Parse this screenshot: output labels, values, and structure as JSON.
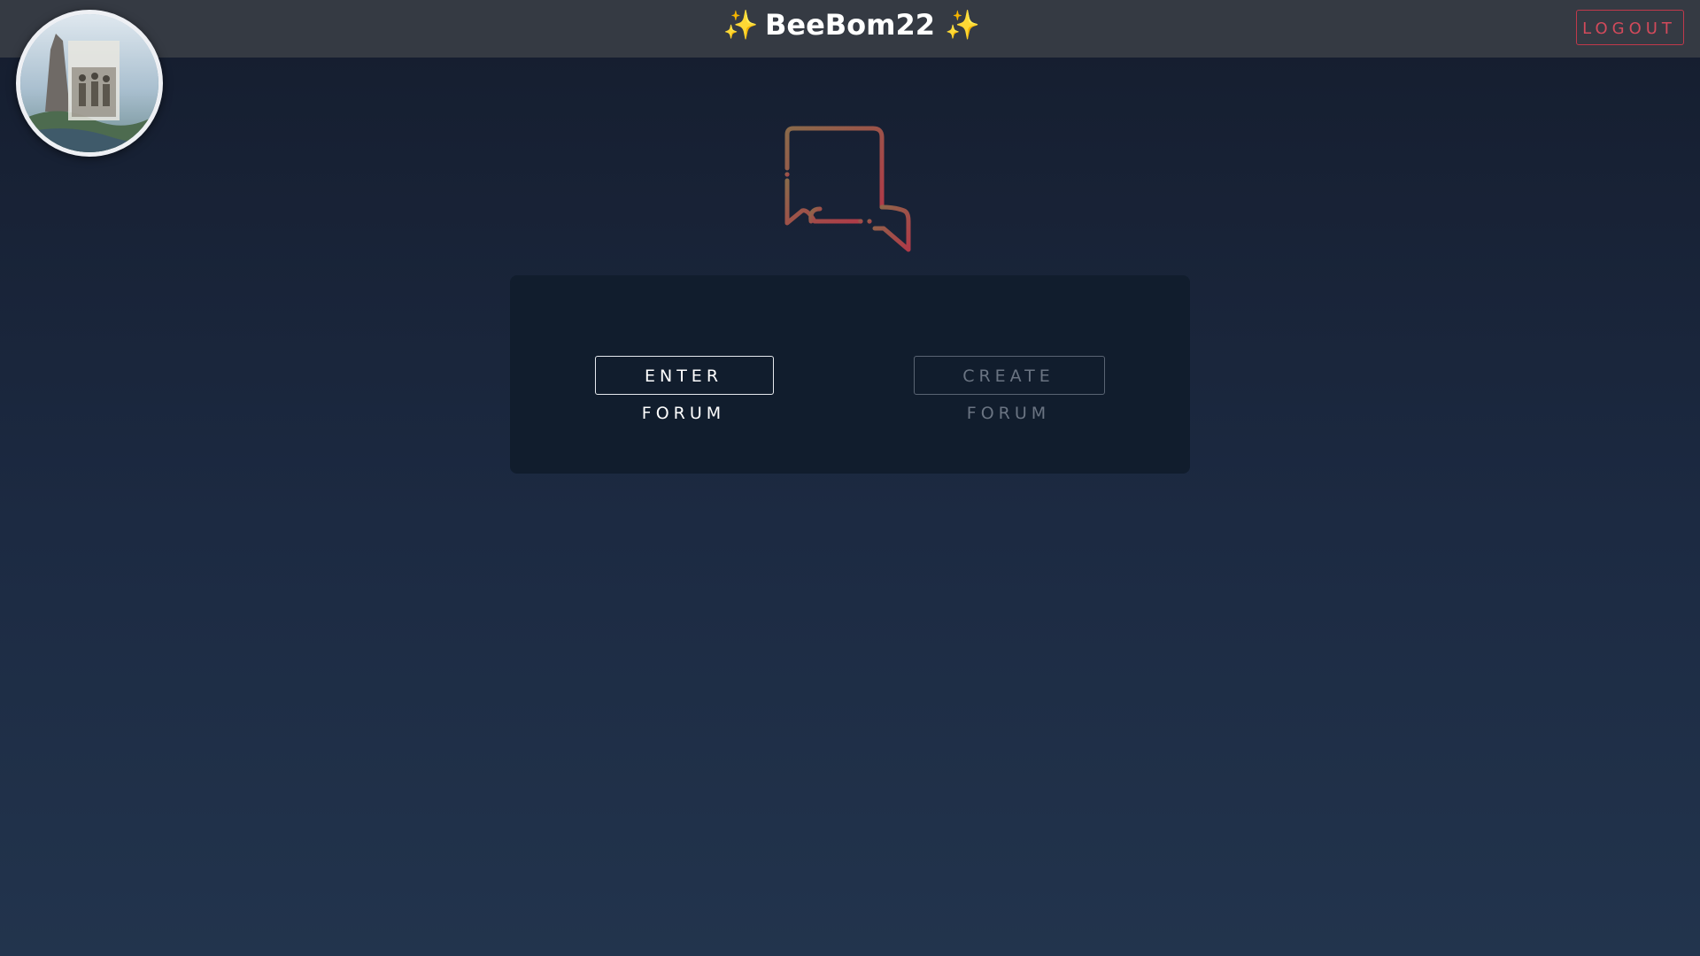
{
  "header": {
    "title": "BeeBom22",
    "sparkle_left": "✨",
    "sparkle_right": "✨",
    "logout_label": "LOGOUT"
  },
  "avatar": {
    "icon": "user-avatar-photo"
  },
  "hero": {
    "icon": "chat-bubbles-icon"
  },
  "panel": {
    "enter_label": "ENTER FORUM",
    "create_label": "CREATE FORUM"
  },
  "colors": {
    "topbar": "#353a43",
    "background_top": "#151d2e",
    "background_bottom": "#22344d",
    "panel": "#111d2d",
    "logout_accent": "#c0394b",
    "sparkle": "#f5c842",
    "icon_gradient_start": "#8a6a4a",
    "icon_gradient_end": "#b03a48"
  }
}
